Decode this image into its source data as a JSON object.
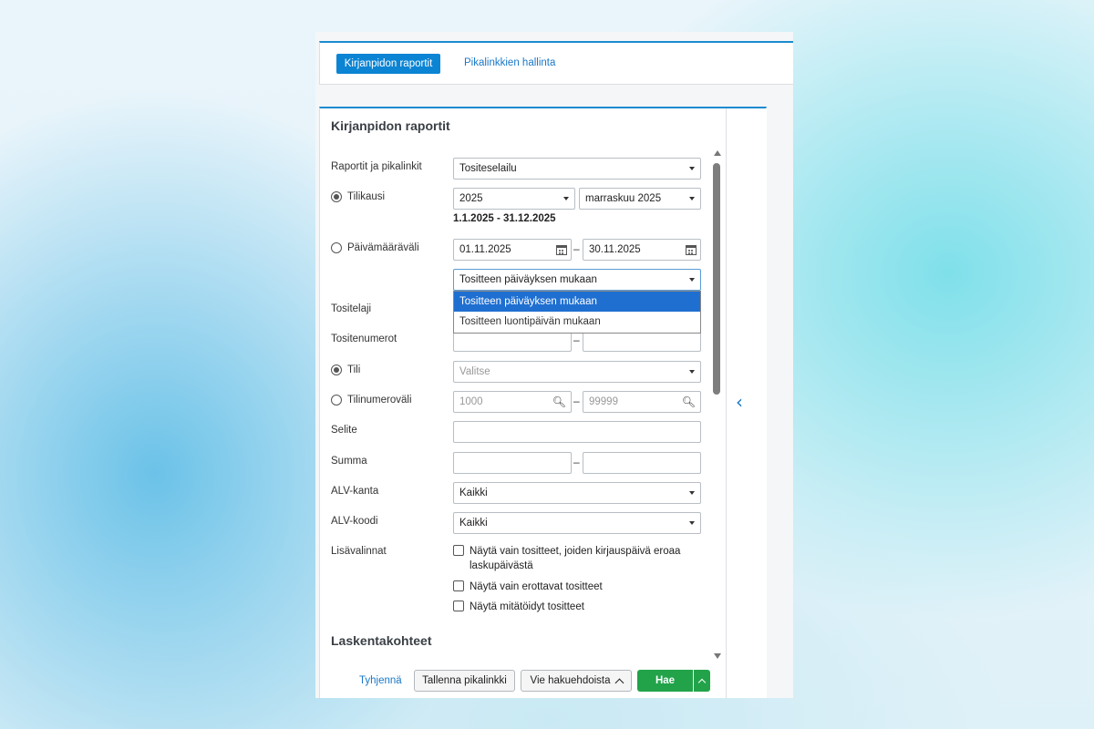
{
  "tabs": {
    "active_label": "Kirjanpidon raportit",
    "link_label": "Pikalinkkien hallinta"
  },
  "panel": {
    "title": "Kirjanpidon raportit",
    "section2_title": "Laskentakohteet"
  },
  "form": {
    "reports": {
      "label": "Raportit ja pikalinkit",
      "value": "Tositeselailu"
    },
    "period": {
      "label": "Tilikausi",
      "selected": true,
      "year": "2025",
      "month": "marraskuu 2025",
      "range_text": "1.1.2025 - 31.12.2025"
    },
    "date_range": {
      "label": "Päivämääräväli",
      "selected": false,
      "from": "01.11.2025",
      "to": "30.11.2025",
      "separator": "–"
    },
    "date_mode": {
      "value": "Tositteen päiväyksen mukaan",
      "options": [
        "Tositteen päiväyksen mukaan",
        "Tositteen luontipäivän mukaan"
      ]
    },
    "voucher_type": {
      "label": "Tositelaji"
    },
    "voucher_numbers": {
      "label": "Tositenumerot",
      "separator": "–"
    },
    "account": {
      "label": "Tili",
      "selected": true,
      "placeholder": "Valitse"
    },
    "account_range": {
      "label": "Tilinumeroväli",
      "selected": false,
      "from_placeholder": "1000",
      "to_placeholder": "99999",
      "separator": "–"
    },
    "description": {
      "label": "Selite"
    },
    "amount": {
      "label": "Summa",
      "separator": "–"
    },
    "vat_rate": {
      "label": "ALV-kanta",
      "value": "Kaikki"
    },
    "vat_code": {
      "label": "ALV-koodi",
      "value": "Kaikki"
    },
    "extra": {
      "label": "Lisävalinnat",
      "options": [
        "Näytä vain tositteet, joiden kirjauspäivä eroaa laskupäivästä",
        "Näytä vain erottavat tositteet",
        "Näytä mitätöidyt tositteet"
      ]
    }
  },
  "footer": {
    "clear": "Tyhjennä",
    "save_link": "Tallenna pikalinkki",
    "export": "Vie hakuehdoista",
    "search": "Hae"
  },
  "colors": {
    "accent": "#0b84d4",
    "primary_button": "#22a34a",
    "dropdown_selected": "#1f6fd1"
  },
  "icons": {
    "calendar": "calendar-icon",
    "search": "search-icon",
    "collapse": "chevron-left-icon"
  }
}
